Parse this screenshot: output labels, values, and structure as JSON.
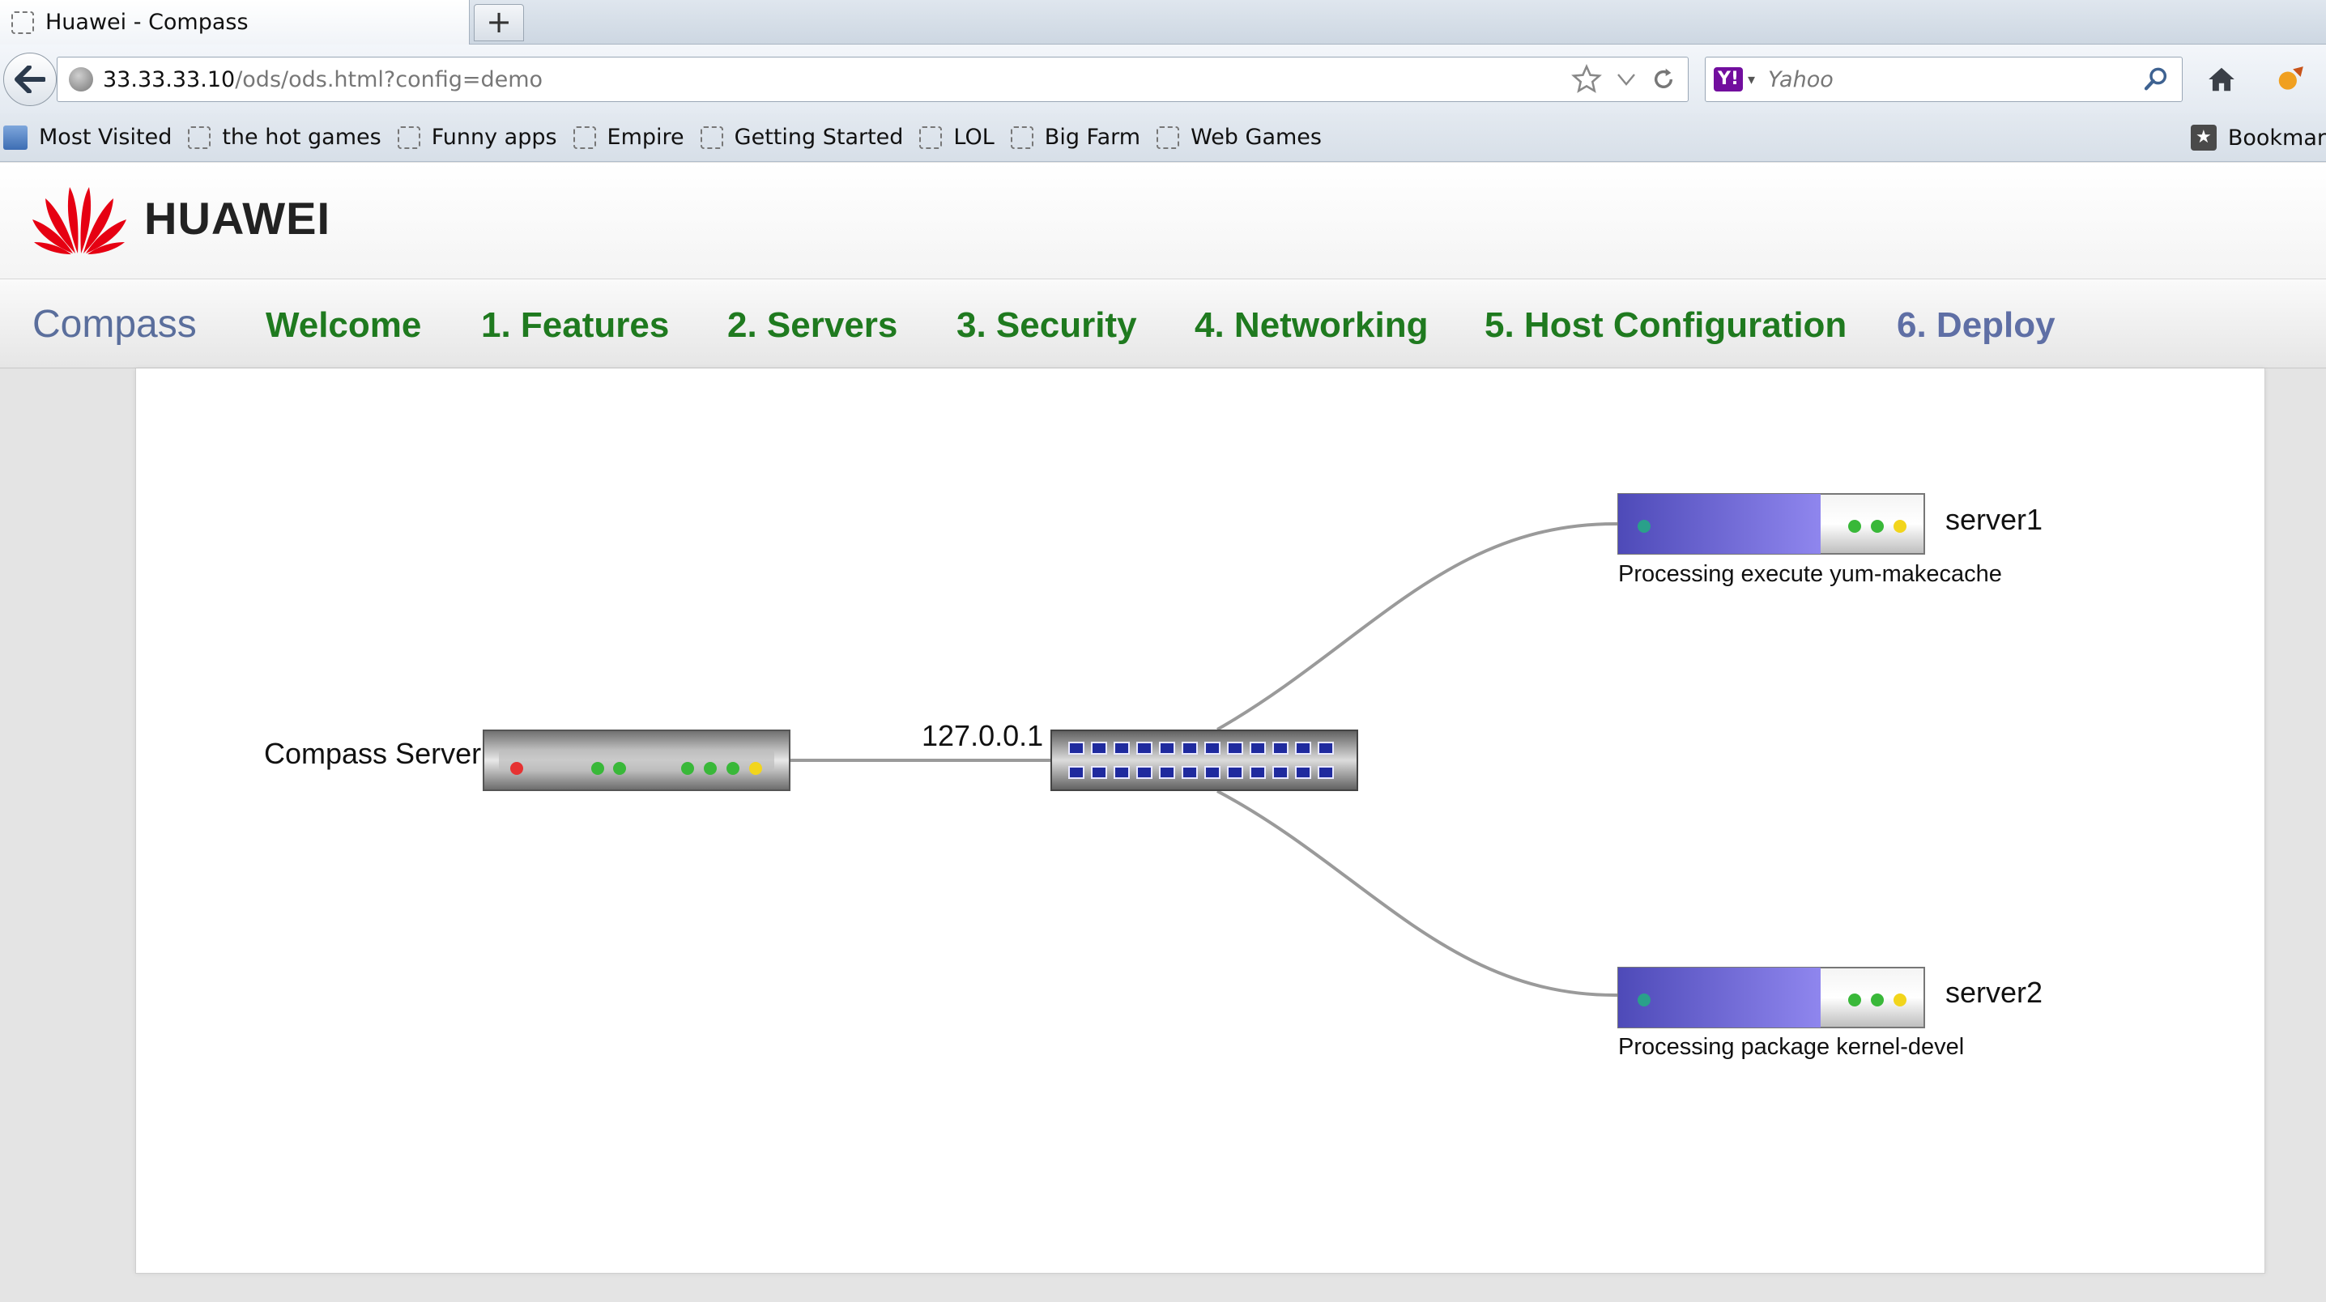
{
  "browser": {
    "tab_title": "Huawei - Compass",
    "newtab_label": "+",
    "url_host": "33.33.33.10",
    "url_path": "/ods/ods.html?config=demo",
    "search_placeholder": "Yahoo",
    "search_engine_badge": "Y!",
    "bookmarks": [
      "Most Visited",
      "the hot games",
      "Funny apps",
      "Empire",
      "Getting Started",
      "LOL",
      "Big Farm",
      "Web Games"
    ],
    "bookmarks_menu_label": "Bookmar"
  },
  "header": {
    "logo_text": "HUAWEI",
    "brand_color": "#e60012"
  },
  "menu": {
    "brand": "Compass",
    "items": [
      {
        "label": "Welcome"
      },
      {
        "label": "1. Features"
      },
      {
        "label": "2. Servers"
      },
      {
        "label": "3. Security"
      },
      {
        "label": "4. Networking"
      },
      {
        "label": "5. Host Configuration"
      },
      {
        "label": "6. Deploy"
      }
    ],
    "active_color": "#1f7a1f",
    "inactive_color": "#5f6fa5"
  },
  "topology": {
    "compass_server": {
      "label": "Compass Server"
    },
    "switch": {
      "ip": "127.0.0.1"
    },
    "servers": [
      {
        "name": "server1",
        "status": "Processing execute yum-makecache"
      },
      {
        "name": "server2",
        "status": "Processing package kernel-devel"
      }
    ]
  }
}
